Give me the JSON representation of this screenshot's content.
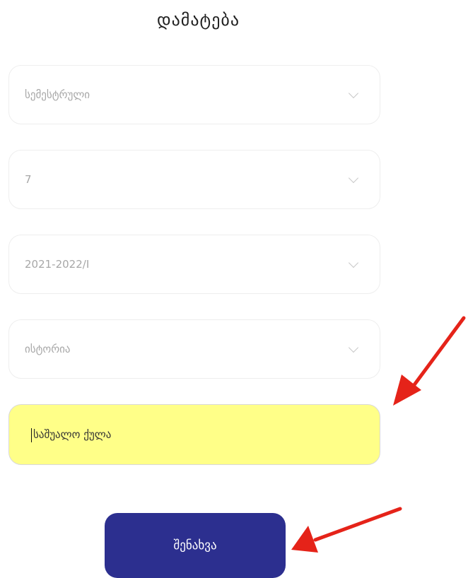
{
  "title": "დამატება",
  "fields": {
    "type": {
      "value": "სემესტრული"
    },
    "semester": {
      "value": "7"
    },
    "year": {
      "value": "2021-2022/I"
    },
    "subject": {
      "value": "ისტორია"
    }
  },
  "grade_input": {
    "placeholder": "საშუალო ქულა",
    "value": ""
  },
  "save_button": {
    "label": "შენახვა"
  },
  "colors": {
    "highlight": "#ffff88",
    "button": "#2c2f8f",
    "annotation_arrow": "#e52319"
  },
  "annotations": [
    "arrow pointing to grade input",
    "arrow pointing to save button"
  ]
}
